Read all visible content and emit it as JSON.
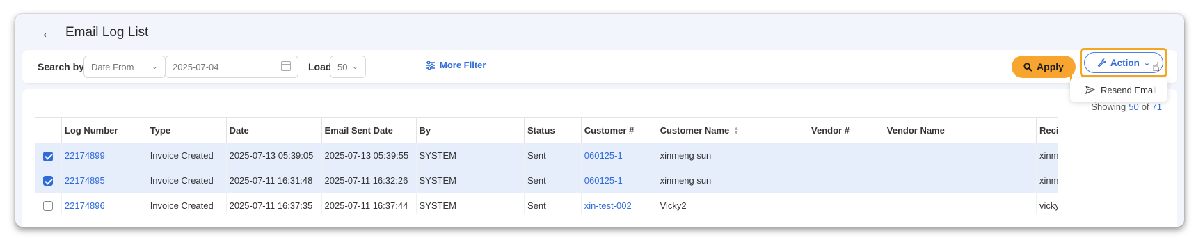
{
  "header": {
    "title": "Email Log List"
  },
  "filters": {
    "search_by_label": "Search by",
    "search_by_value": "Date From",
    "date_value": "2025-07-04",
    "load_label": "Load",
    "load_value": "50",
    "more_filter_label": "More Filter",
    "apply_label": "Apply",
    "action_label": "Action"
  },
  "action_menu": {
    "items": [
      {
        "label": "Resend Email"
      }
    ]
  },
  "showing": {
    "prefix": "Showing",
    "count": "50",
    "of": "of",
    "total": "71"
  },
  "table": {
    "columns": [
      "Log Number",
      "Type",
      "Date",
      "Email Sent Date",
      "By",
      "Status",
      "Customer #",
      "Customer Name",
      "Vendor #",
      "Vendor Name",
      "Reci"
    ],
    "rows": [
      {
        "checked": true,
        "log": "22174899",
        "type": "Invoice Created",
        "date": "2025-07-13 05:39:05",
        "sent": "2025-07-13 05:39:55",
        "by": "SYSTEM",
        "status": "Sent",
        "cust_no": "060125-1",
        "cust_name": "xinmeng sun",
        "vendor_no": "",
        "vendor_name": "",
        "recip": "xinm"
      },
      {
        "checked": true,
        "log": "22174895",
        "type": "Invoice Created",
        "date": "2025-07-11 16:31:48",
        "sent": "2025-07-11 16:32:26",
        "by": "SYSTEM",
        "status": "Sent",
        "cust_no": "060125-1",
        "cust_name": "xinmeng sun",
        "vendor_no": "",
        "vendor_name": "",
        "recip": "xinm"
      },
      {
        "checked": false,
        "log": "22174896",
        "type": "Invoice Created",
        "date": "2025-07-11 16:37:35",
        "sent": "2025-07-11 16:37:44",
        "by": "SYSTEM",
        "status": "Sent",
        "cust_no": "xin-test-002",
        "cust_name": "Vicky2",
        "vendor_no": "",
        "vendor_name": "",
        "recip": "vicky"
      }
    ]
  },
  "colors": {
    "accent": "#2f6bd9",
    "apply": "#f7a52e",
    "highlight": "#f5a623",
    "selected_row": "#e6eefc"
  }
}
